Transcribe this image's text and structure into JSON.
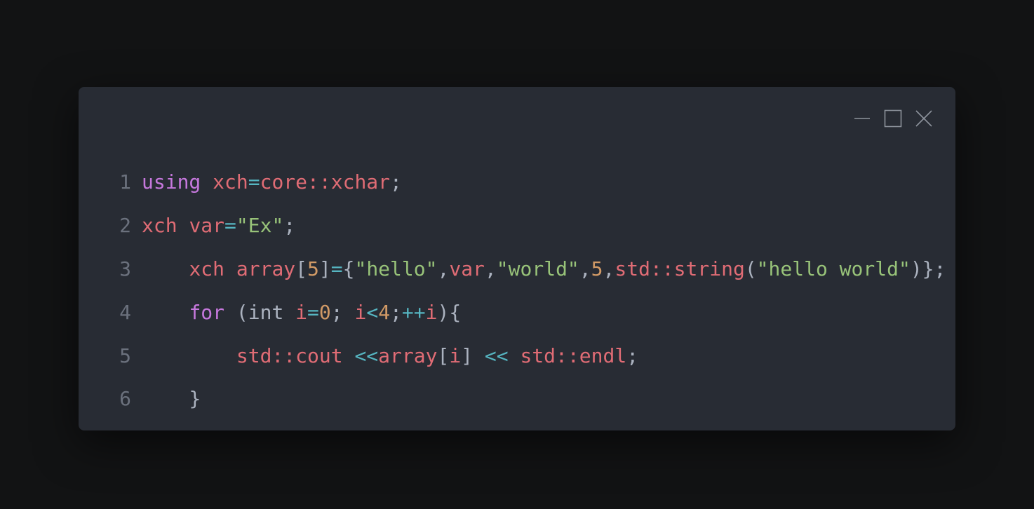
{
  "window": {
    "controls": {
      "minimize_icon": "minimize-icon",
      "maximize_icon": "maximize-icon",
      "close_icon": "close-icon"
    }
  },
  "colors": {
    "keyword": "#c678dd",
    "identifier": "#e06c75",
    "operator": "#56b6c2",
    "number": "#d19a66",
    "string": "#98c379",
    "plain": "#abb2bf",
    "line_number": "#6b717d",
    "background": "#282c34"
  },
  "code": {
    "lines": [
      {
        "number": "1",
        "tokens": [
          {
            "t": "using",
            "c": "keyword"
          },
          {
            "t": " ",
            "c": "plain"
          },
          {
            "t": "xch",
            "c": "identifier"
          },
          {
            "t": "=",
            "c": "operator"
          },
          {
            "t": "core::xchar",
            "c": "identifier"
          },
          {
            "t": ";",
            "c": "plain"
          }
        ]
      },
      {
        "number": "2",
        "tokens": [
          {
            "t": "xch",
            "c": "identifier"
          },
          {
            "t": " ",
            "c": "plain"
          },
          {
            "t": "var",
            "c": "identifier"
          },
          {
            "t": "=",
            "c": "operator"
          },
          {
            "t": "\"Ex\"",
            "c": "string"
          },
          {
            "t": ";",
            "c": "plain"
          }
        ]
      },
      {
        "number": "3",
        "tokens": [
          {
            "t": "    ",
            "c": "plain"
          },
          {
            "t": "xch",
            "c": "identifier"
          },
          {
            "t": " ",
            "c": "plain"
          },
          {
            "t": "array",
            "c": "identifier"
          },
          {
            "t": "[",
            "c": "plain"
          },
          {
            "t": "5",
            "c": "number"
          },
          {
            "t": "]",
            "c": "plain"
          },
          {
            "t": "=",
            "c": "operator"
          },
          {
            "t": "{",
            "c": "plain"
          },
          {
            "t": "\"hello\"",
            "c": "string"
          },
          {
            "t": ",",
            "c": "plain"
          },
          {
            "t": "var",
            "c": "identifier"
          },
          {
            "t": ",",
            "c": "plain"
          },
          {
            "t": "\"world\"",
            "c": "string"
          },
          {
            "t": ",",
            "c": "plain"
          },
          {
            "t": "5",
            "c": "number"
          },
          {
            "t": ",",
            "c": "plain"
          },
          {
            "t": "std::string",
            "c": "identifier"
          },
          {
            "t": "(",
            "c": "plain"
          },
          {
            "t": "\"hello world\"",
            "c": "string"
          },
          {
            "t": ")};",
            "c": "plain"
          }
        ]
      },
      {
        "number": "4",
        "tokens": [
          {
            "t": "    ",
            "c": "plain"
          },
          {
            "t": "for",
            "c": "keyword"
          },
          {
            "t": " (int ",
            "c": "plain"
          },
          {
            "t": "i",
            "c": "identifier"
          },
          {
            "t": "=",
            "c": "operator"
          },
          {
            "t": "0",
            "c": "number"
          },
          {
            "t": "; ",
            "c": "plain"
          },
          {
            "t": "i",
            "c": "identifier"
          },
          {
            "t": "<",
            "c": "operator"
          },
          {
            "t": "4",
            "c": "number"
          },
          {
            "t": ";",
            "c": "plain"
          },
          {
            "t": "++",
            "c": "operator"
          },
          {
            "t": "i",
            "c": "identifier"
          },
          {
            "t": "){",
            "c": "plain"
          }
        ]
      },
      {
        "number": "5",
        "tokens": [
          {
            "t": "        ",
            "c": "plain"
          },
          {
            "t": "std::cout",
            "c": "identifier"
          },
          {
            "t": " ",
            "c": "plain"
          },
          {
            "t": "<<",
            "c": "operator"
          },
          {
            "t": "array",
            "c": "identifier"
          },
          {
            "t": "[",
            "c": "plain"
          },
          {
            "t": "i",
            "c": "identifier"
          },
          {
            "t": "] ",
            "c": "plain"
          },
          {
            "t": "<<",
            "c": "operator"
          },
          {
            "t": " ",
            "c": "plain"
          },
          {
            "t": "std::endl",
            "c": "identifier"
          },
          {
            "t": ";",
            "c": "plain"
          }
        ]
      },
      {
        "number": "6",
        "tokens": [
          {
            "t": "    ",
            "c": "plain"
          },
          {
            "t": "}",
            "c": "plain"
          }
        ]
      }
    ]
  }
}
